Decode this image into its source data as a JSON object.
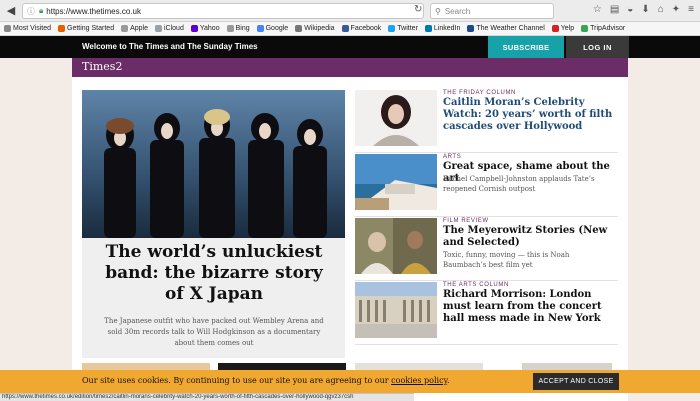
{
  "browser": {
    "url": "https://www.thetimes.co.uk",
    "search_placeholder": "Search",
    "bookmarks": [
      {
        "label": "Most Visited",
        "color": "#888888"
      },
      {
        "label": "Getting Started",
        "color": "#e66000"
      },
      {
        "label": "Apple",
        "color": "#999999"
      },
      {
        "label": "iCloud",
        "color": "#9aa0a6"
      },
      {
        "label": "Yahoo",
        "color": "#6001d2"
      },
      {
        "label": "Bing",
        "color": "#999999"
      },
      {
        "label": "Google",
        "color": "#4285f4"
      },
      {
        "label": "Wikipedia",
        "color": "#777777"
      },
      {
        "label": "Facebook",
        "color": "#3b5998"
      },
      {
        "label": "Twitter",
        "color": "#1da1f2"
      },
      {
        "label": "LinkedIn",
        "color": "#0077b5"
      },
      {
        "label": "The Weather Channel",
        "color": "#1a4a8a"
      },
      {
        "label": "Yelp",
        "color": "#d32323"
      },
      {
        "label": "TripAdvisor",
        "color": "#34a853"
      }
    ],
    "status_url": "https://www.thetimes.co.uk/edition/times2/caitlin-morans-celebrity-watch-20-years-worth-of-filth-cascades-over-hollywood-qgvz37csh"
  },
  "header": {
    "welcome": "Welcome to The Times and The Sunday Times",
    "subscribe": "SUBSCRIBE",
    "login": "LOG IN",
    "section": "Times2"
  },
  "hero": {
    "title": "The world’s unluckiest band: the bizarre story of X Japan",
    "description": "The Japanese outfit who have packed out Wembley Arena and sold 30m records talk to Will Hodgkinson as a documentary about them comes out"
  },
  "articles": [
    {
      "kicker": "THE FRIDAY COLUMN",
      "headline": "Caitlin Moran’s Celebrity Watch: 20 years’ worth of filth cascades over Hollywood",
      "sub": ""
    },
    {
      "kicker": "ARTS",
      "headline": "Great space, shame about the art",
      "sub": "Rachel Campbell-Johnston applauds Tate’s reopened Cornish outpost"
    },
    {
      "kicker": "FILM REVIEW",
      "headline": "The Meyerowitz Stories (New and Selected)",
      "sub": "Toxic, funny, moving — this is Noah Baumbach’s best film yet"
    },
    {
      "kicker": "THE ARTS COLUMN",
      "headline": "Richard Morrison: London must learn from the concert hall mess made in New York",
      "sub": ""
    }
  ],
  "cookie": {
    "text": "Our site uses cookies. By continuing to use our site you are agreeing to our ",
    "link": "cookies policy",
    "end": ".",
    "button": "ACCEPT AND CLOSE"
  }
}
